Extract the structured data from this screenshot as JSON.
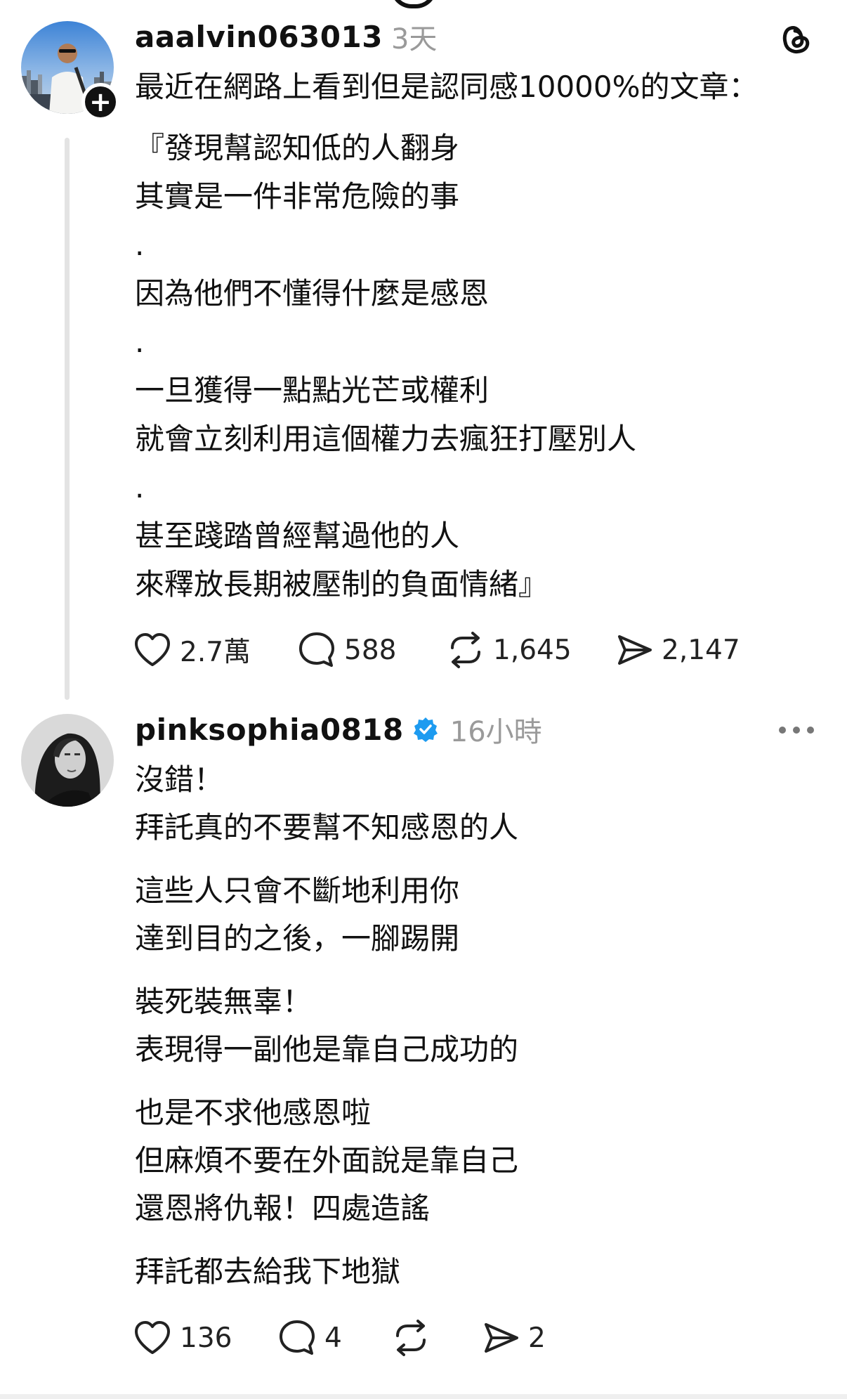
{
  "post": {
    "username": "aaalvin063013",
    "timestamp": "3天",
    "intro": "最近在網路上看到但是認同感10000%的文章：",
    "quote_lines": [
      "『發現幫認知低的人翻身",
      "其實是一件非常危險的事",
      ".",
      "因為他們不懂得什麼是感恩",
      ".",
      "一旦獲得一點點光芒或權利",
      "就會立刻利用這個權力去瘋狂打壓別人",
      ".",
      "甚至踐踏曾經幫過他的人",
      "來釋放長期被壓制的負面情緒』"
    ],
    "actions": {
      "likes": "2.7萬",
      "comments": "588",
      "reposts": "1,645",
      "shares": "2,147"
    }
  },
  "reply": {
    "username": "pinksophia0818",
    "verified": true,
    "timestamp": "16小時",
    "lines": [
      "沒錯！",
      "拜託真的不要幫不知感恩的人",
      "這些人只會不斷地利用你",
      "達到目的之後，一腳踢開",
      "裝死裝無辜！",
      "表現得一副他是靠自己成功的",
      "也是不求他感恩啦",
      "但麻煩不要在外面說是靠自己",
      "還恩將仇報！四處造謠",
      "拜託都去給我下地獄"
    ],
    "actions": {
      "likes": "136",
      "comments": "4",
      "shares": "2"
    }
  },
  "icons": {
    "top_right": "threads-logo-icon",
    "reply_menu": "more-icon",
    "follow": "plus-icon",
    "verified": "verified-badge-icon",
    "like": "heart-icon",
    "comment": "comment-icon",
    "repost": "repost-icon",
    "share": "send-icon"
  },
  "colors": {
    "verified": "#1d9bf0",
    "timestamp": "#9a9a9a",
    "thread_line": "#e3e3e3"
  }
}
